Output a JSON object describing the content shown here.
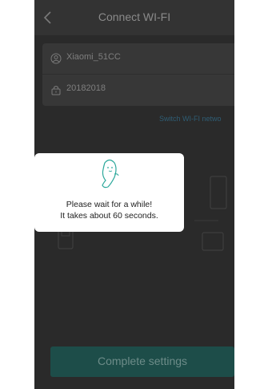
{
  "header": {
    "title": "Connect WI-FI",
    "back_icon": "chevron-left-icon"
  },
  "form": {
    "ssid": {
      "icon": "user-circle-icon",
      "value": "Xiaomi_51CC"
    },
    "password": {
      "icon": "lock-icon",
      "value": "20182018"
    }
  },
  "switch_network_label": "Switch WI-FI netwo",
  "modal": {
    "icon": "mascot-icon",
    "line1": "Please wait for a while!",
    "line2": "It takes about 60 seconds."
  },
  "footer": {
    "complete_label": "Complete settings"
  },
  "colors": {
    "page_bg": "#2a2a2a",
    "header_bg": "#333333",
    "accent": "#2f5d74",
    "button_bg": "#1d4d49",
    "modal_bg": "#ffffff"
  }
}
